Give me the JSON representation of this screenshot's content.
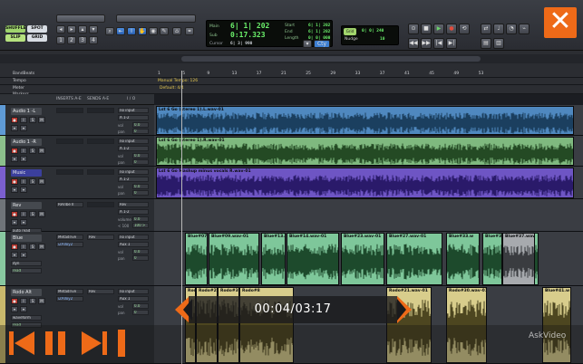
{
  "toolbar": {
    "mode_top": "SHUFFLE",
    "mode_top2": "SPOT",
    "mode_bottom": "SLIP",
    "mode_bottom2": "GRID",
    "counter_main_label": "Main",
    "counter_main_value": "6| 1| 202",
    "counter_sub_label": "Sub",
    "counter_sub_value": "0:17.323",
    "start_label": "Start",
    "start_value": "6| 1| 202",
    "end_label": "End",
    "end_value": "6| 1| 202",
    "length_label": "Length",
    "length_value": "0| 0| 000",
    "cursor_label": "Cursor",
    "cursor_value": "6| 3| 990",
    "grid_label": "Grid",
    "grid_value": "0| 0| 240",
    "nudge_label": "Nudge",
    "nudge_value": "10",
    "close_glyph": "✕"
  },
  "ruler": {
    "session_name": "BandBeats",
    "rows": [
      "Tempo",
      "Meter",
      "Markers"
    ],
    "tempo_text": "Manual Tempo: 126",
    "meter_text": "Default: 4/4",
    "bars": [
      "1",
      "5",
      "9",
      "13",
      "17",
      "21",
      "25",
      "29",
      "33",
      "37",
      "41",
      "45",
      "49",
      "53"
    ]
  },
  "columns": {
    "inserts": "INSERTS A-E",
    "sends": "SENDS A-E",
    "io": "I / O"
  },
  "tracks": [
    {
      "name": "Audio 1 -L",
      "color": "#5f9bd6",
      "input": "no input",
      "output": "A 1-2",
      "vol": "vol",
      "vol_val": "0.0",
      "pan": "pan",
      "pan_val": "0"
    },
    {
      "name": "Audio 1 -R",
      "color": "#8cc08c",
      "input": "no input",
      "output": "A 1-2",
      "vol": "vol",
      "vol_val": "0.0",
      "pan": "pan",
      "pan_val": "0"
    },
    {
      "name": "Music",
      "color": "#7b5fcf",
      "input": "no input",
      "output": "A 1-2",
      "vol": "vol",
      "vol_val": "0.0",
      "pan": "pan",
      "pan_val": "0"
    },
    {
      "name": "Rev",
      "color": "#6f7479",
      "insert": "ReVibe II",
      "input": "Rev",
      "output": "A 1-2",
      "vol": "volume",
      "vol_val": "0.0",
      "pan": "< 100",
      "pan_val": "100 >",
      "extra": "auto read"
    },
    {
      "name": "Blue",
      "color": "#88c8a0",
      "insert": "Metadrive",
      "insert2": "iZAlloy2",
      "send": "Rev",
      "input": "no input",
      "output": "Aux 1",
      "vol": "vol",
      "vol_val": "0.0",
      "pan": "pan",
      "pan_val": "0",
      "extra": "dyn",
      "extra2": "read"
    },
    {
      "name": "Rodo Alt",
      "color": "#c8b86c",
      "insert": "Metadrive",
      "insert2": "iZAlloy2",
      "send": "Rev",
      "input": "no input",
      "output": "Aux 1",
      "vol": "vol",
      "vol_val": "0.0",
      "pan": "pan",
      "pan_val": "0",
      "extra": "waveform",
      "extra2": "read"
    }
  ],
  "clips": {
    "audio_l": "Lst 6 Go (stereo 1).L.wav-01",
    "audio_r": "Lst 6 Go (stereo 1).R.wav-01",
    "music": "Lst 6 Go Mashup minus vocals R.wav-01",
    "blue": [
      "Blue#07.w",
      "Blue#09.wav-01",
      "Blue#13.w",
      "Blue#14.wav-01",
      "Blue#23.wav-01",
      "Blue#27.wav-01",
      "Blue#33.w",
      "Blue#37.wav-01",
      "Blue#41.w"
    ],
    "rodo": [
      "Rodo#1",
      "Rodo#2",
      "Rodo#3",
      "Rodo#8",
      "Rodo#21.wav-01",
      "Rodo#30.wav-01",
      "Blue#41.w"
    ]
  },
  "overlay": {
    "time": "00:04/03:17",
    "watermark": "AskVideo"
  },
  "colors": {
    "accent": "#ee6a18",
    "audio_l": "#5f9bd6",
    "audio_r": "#8cc08c",
    "music": "#7b5fcf",
    "blue_track": "#88c8a0",
    "rodo_track": "#d4c98a"
  }
}
